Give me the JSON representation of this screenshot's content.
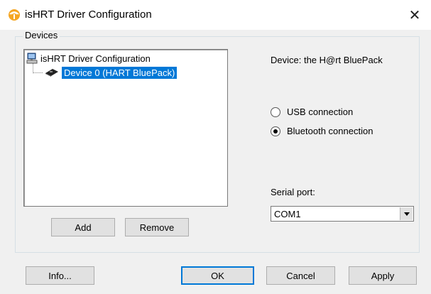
{
  "window": {
    "title": "isHRT Driver Configuration",
    "close_glyph": "✕",
    "icon": "hart-logo-icon",
    "accent": "#f5a623"
  },
  "devices_group": {
    "label": "Devices"
  },
  "tree": {
    "root_label": "isHRT Driver Configuration",
    "root_icon": "computer-icon",
    "child_label": "Device 0  (HART BluePack)",
    "child_icon": "device-icon",
    "selection_color": "#0078d7"
  },
  "device_info": {
    "label": "Device:   the H@rt BluePack"
  },
  "connection": {
    "options": [
      {
        "label": "USB connection",
        "checked": false
      },
      {
        "label": "Bluetooth connection",
        "checked": true
      }
    ]
  },
  "serial_port": {
    "label": "Serial port:",
    "value": "COM1"
  },
  "buttons": {
    "add": "Add",
    "remove": "Remove",
    "info": "Info...",
    "ok": "OK",
    "cancel": "Cancel",
    "apply": "Apply"
  }
}
